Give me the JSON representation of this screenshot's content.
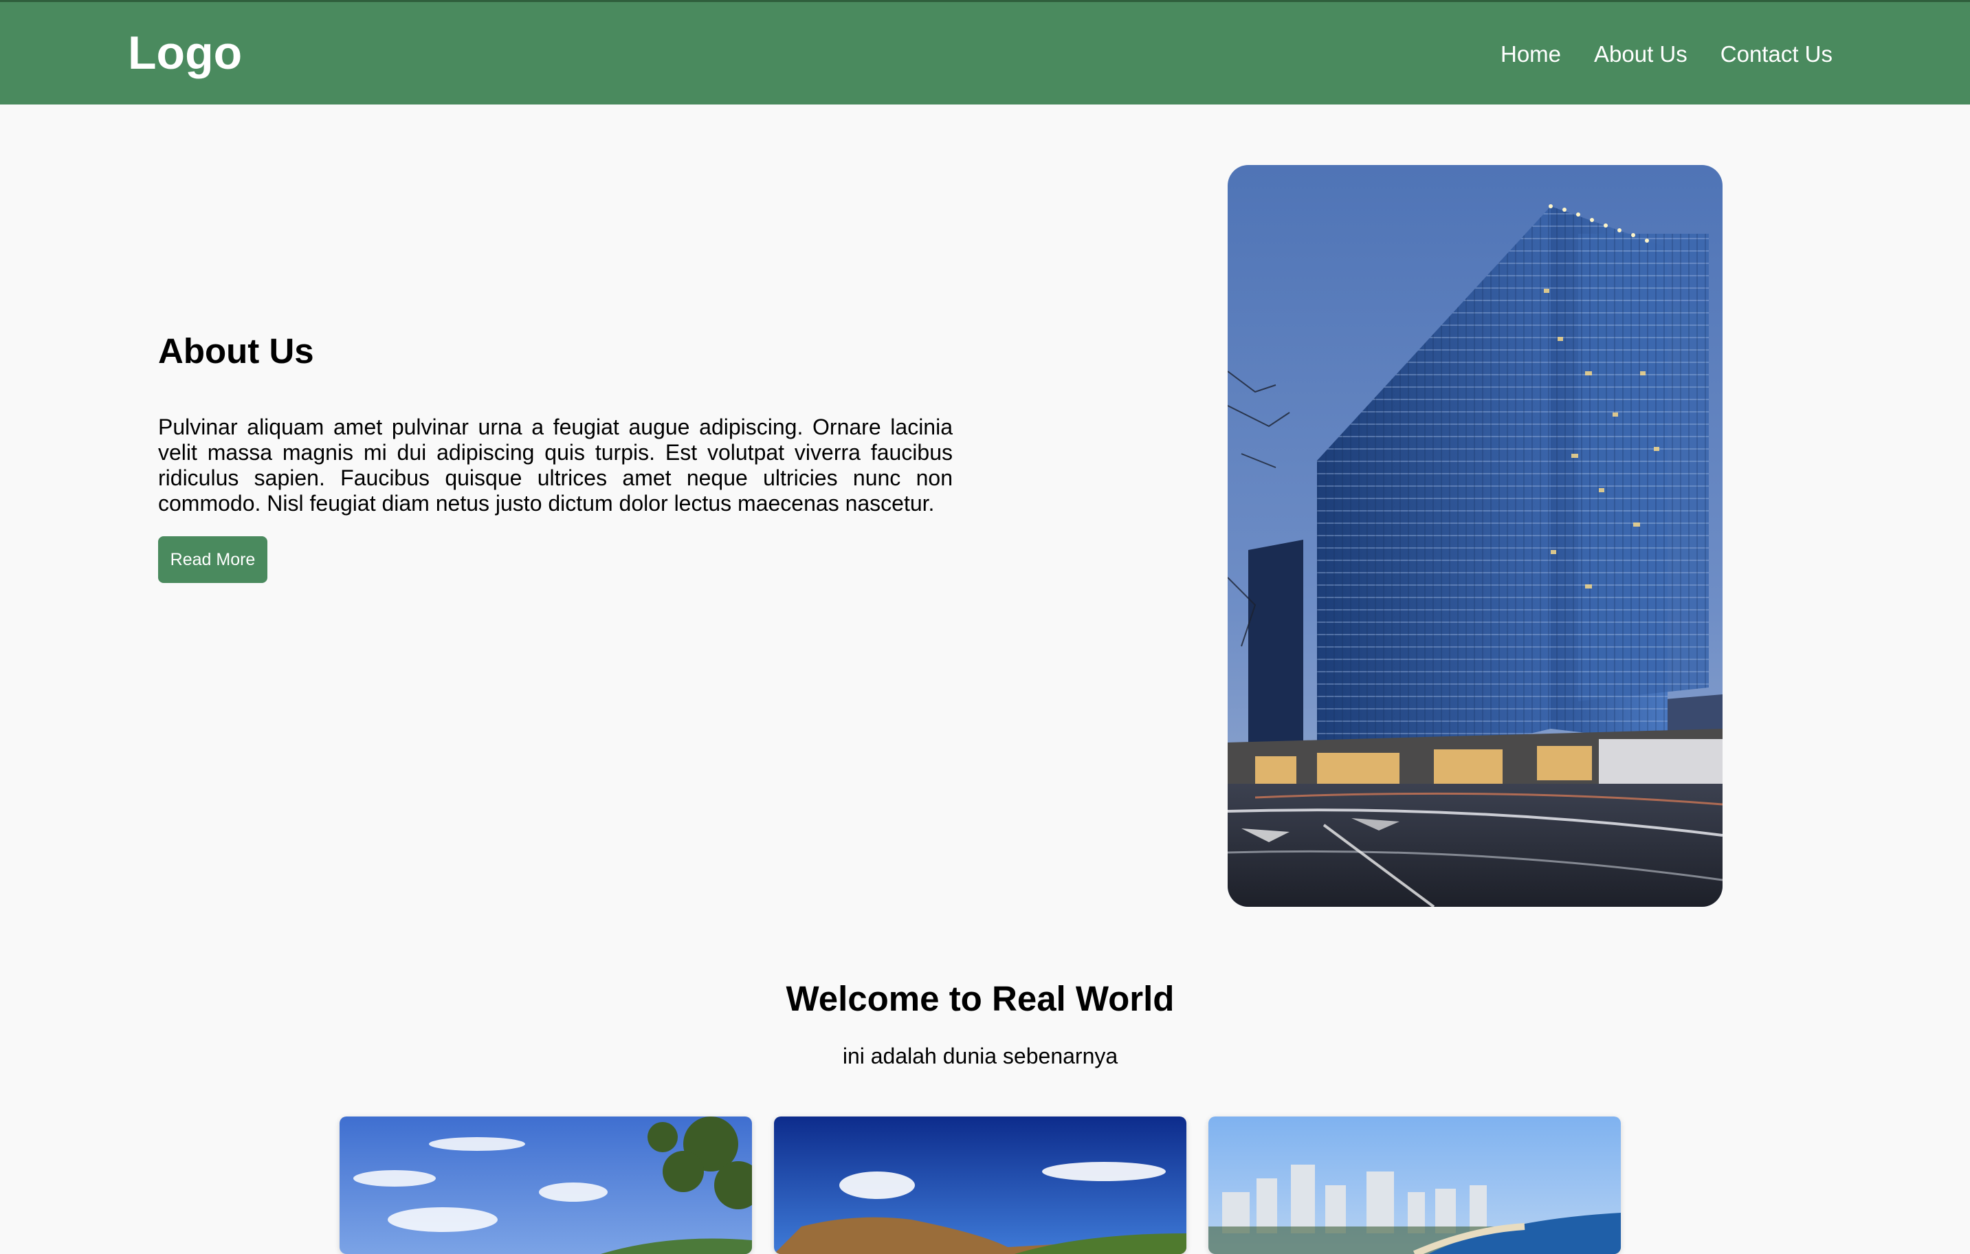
{
  "header": {
    "logo": "Logo",
    "nav": [
      "Home",
      "About Us",
      "Contact Us"
    ]
  },
  "about": {
    "title": "About Us",
    "text": "Pulvinar aliquam amet pulvinar urna a feugiat augue adipiscing. Ornare lacinia velit massa magnis mi dui adipiscing quis turpis. Est volutpat viverra faucibus ridiculus sapien. Faucibus quisque ultrices amet neque ultricies nunc non commodo. Nisl feugiat diam netus justo dictum dolor lectus maecenas nascetur.",
    "button": "Read More"
  },
  "welcome": {
    "title": "Welcome to Real World",
    "subtitle": "ini adalah dunia sebenarnya"
  },
  "colors": {
    "brand": "#4a8a5e",
    "background": "#f9f9f9"
  }
}
